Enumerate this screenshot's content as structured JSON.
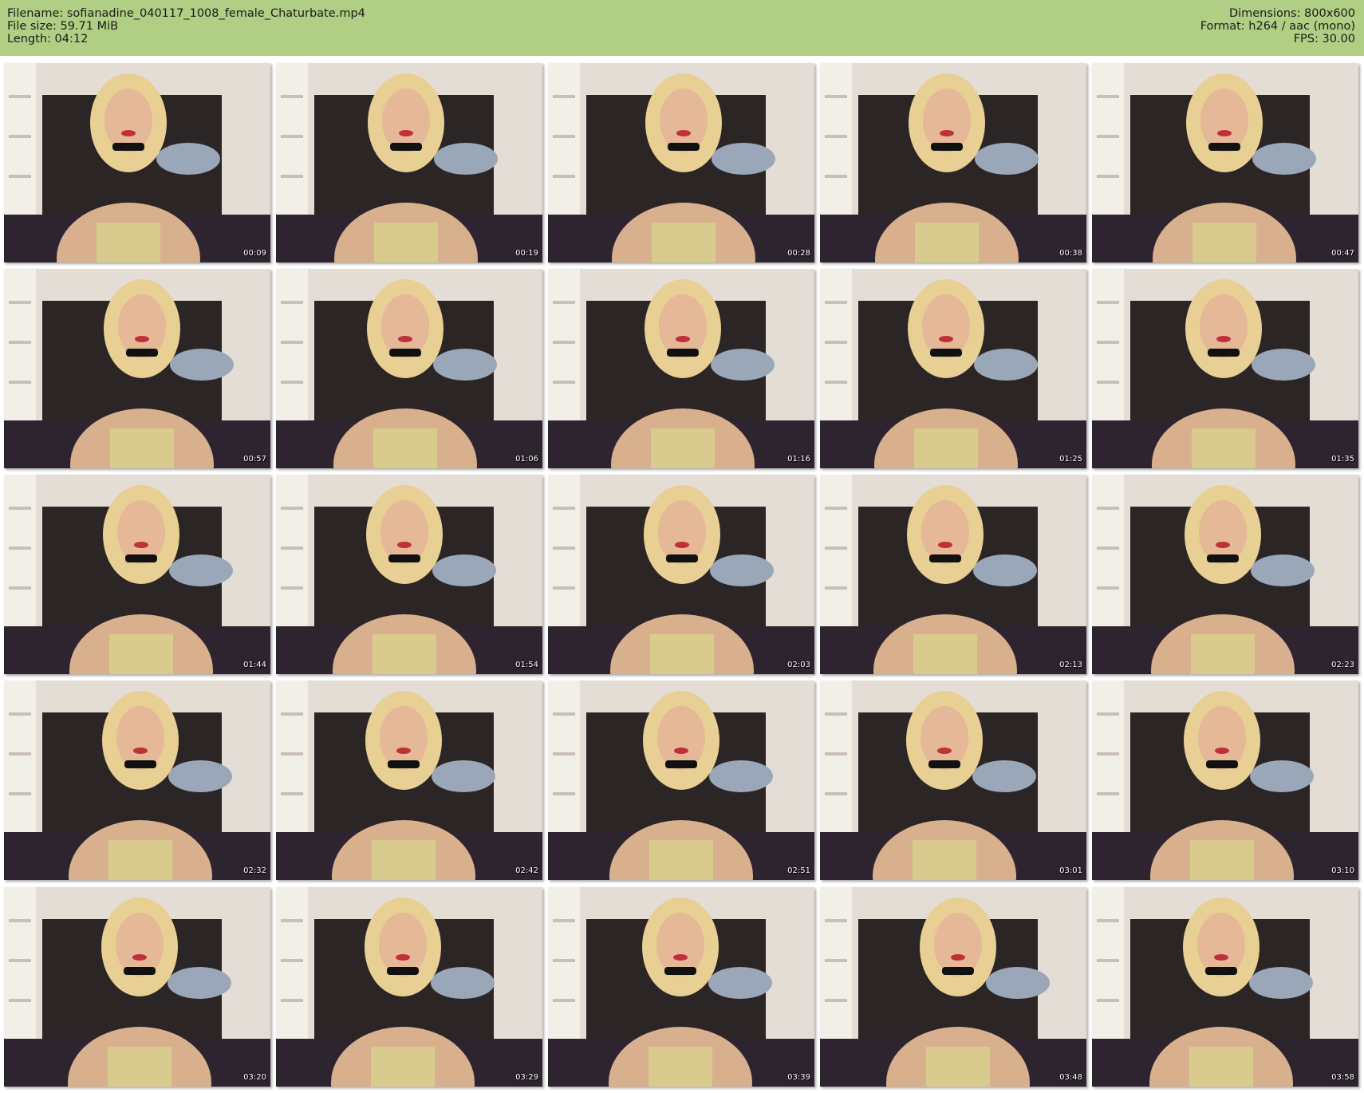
{
  "header": {
    "background_color": "#b0ce84",
    "left_lines": [
      "Filename: sofianadine_040117_1008_female_Chaturbate.mp4",
      "File size: 59.71 MiB",
      "Length: 04:12"
    ],
    "right_lines": [
      "Dimensions: 800x600",
      "Format: h264 / aac (mono)",
      "FPS: 30.00"
    ]
  },
  "thumbnails": [
    {
      "timestamp": "00:09"
    },
    {
      "timestamp": "00:19"
    },
    {
      "timestamp": "00:28"
    },
    {
      "timestamp": "00:38"
    },
    {
      "timestamp": "00:47"
    },
    {
      "timestamp": "00:57"
    },
    {
      "timestamp": "01:06"
    },
    {
      "timestamp": "01:16"
    },
    {
      "timestamp": "01:25"
    },
    {
      "timestamp": "01:35"
    },
    {
      "timestamp": "01:44"
    },
    {
      "timestamp": "01:54"
    },
    {
      "timestamp": "02:03"
    },
    {
      "timestamp": "02:13"
    },
    {
      "timestamp": "02:23"
    },
    {
      "timestamp": "02:32"
    },
    {
      "timestamp": "02:42"
    },
    {
      "timestamp": "02:51"
    },
    {
      "timestamp": "03:01"
    },
    {
      "timestamp": "03:10"
    },
    {
      "timestamp": "03:20"
    },
    {
      "timestamp": "03:29"
    },
    {
      "timestamp": "03:39"
    },
    {
      "timestamp": "03:48"
    },
    {
      "timestamp": "03:58"
    }
  ]
}
